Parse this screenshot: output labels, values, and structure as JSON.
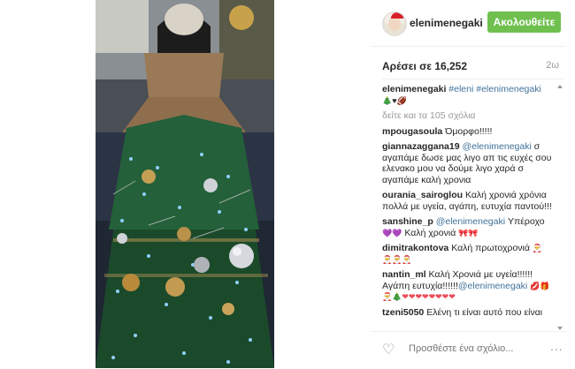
{
  "post": {
    "username": "elenimenegaki",
    "follow_label": "Ακολουθείτε",
    "likes": "Αρέσει σε 16,252",
    "age": "2ω",
    "caption": {
      "user": "elenimenegaki",
      "text": "#eleni #elenimenegaki",
      "emoji": "🎄♥🏈"
    },
    "view_more": "δείτε και τα 105 σχόλια",
    "comments": [
      {
        "user": "mpougasoula",
        "text": "Όμορφο!!!!!"
      },
      {
        "user": "giannazaggana19",
        "mention": "@elenimenegaki",
        "text": "σ αγαπάμε δωσε μας λιγο απ τις ευχές σου ελενακο μου να δούμε λιγο χαρά σ αγαπάμε καλή χρονια"
      },
      {
        "user": "ourania_sairoglou",
        "text": "Καλή χρονιά χρόνια πολλά με υγεία, αγάπη, ευτυχία παντού!!!"
      },
      {
        "user": "sanshine_p",
        "mention": "@elenimenegaki",
        "text": "Υπέροχο",
        "text2": "Καλή χρονιά",
        "emoji": "💜💜",
        "emoji2": "🎀🎀"
      },
      {
        "user": "dimitrakontova",
        "text": "Καλή πρωτοχρονιά",
        "emoji": "🎅",
        "emoji2": "🎅🎅🎅"
      },
      {
        "user": "nantin_ml",
        "text": "Καλή Χρονιά με υγεία!!!!!! Αγάπη ευτυχία!!!!!!",
        "mention": "@elenimenegaki",
        "emoji": "💋🎁",
        "emoji2": "🎅🎄❤❤❤❤❤❤❤❤"
      },
      {
        "user": "tzeni5050",
        "text": "Ελένη τι είναι αυτό που είναι"
      }
    ],
    "comment_placeholder": "Προσθέστε ένα σχόλιο...",
    "more_options": "..."
  },
  "colors": {
    "follow_bg": "#70c050",
    "link": "#3f729b",
    "muted": "#999999"
  }
}
